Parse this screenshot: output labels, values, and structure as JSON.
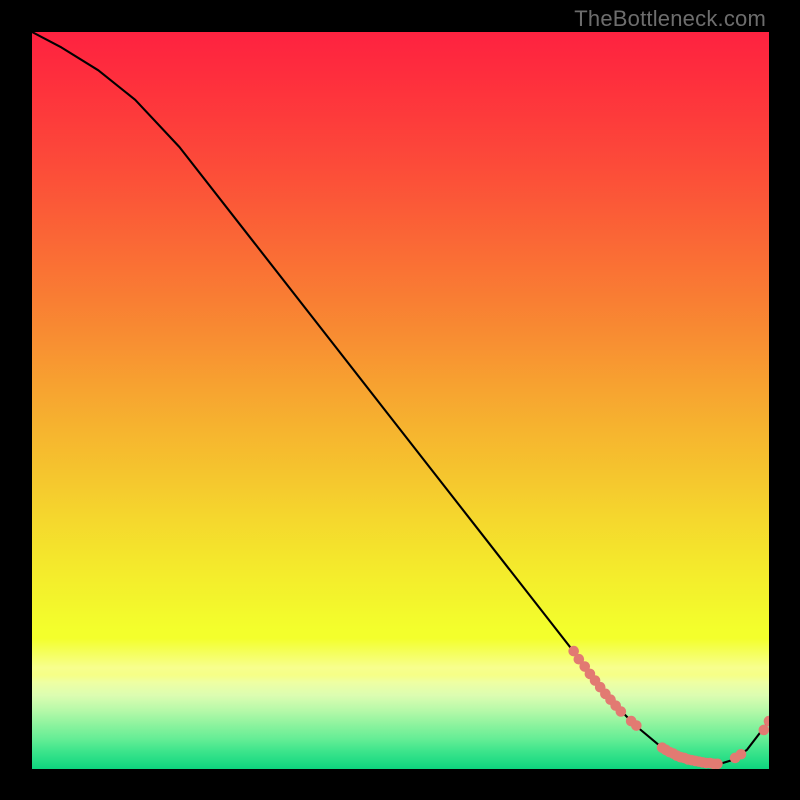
{
  "attribution": "TheBottleneck.com",
  "chart_data": {
    "type": "line",
    "title": "",
    "xlabel": "",
    "ylabel": "",
    "xlim": [
      0,
      100
    ],
    "ylim": [
      0,
      100
    ],
    "series": [
      {
        "name": "curve",
        "x": [
          0,
          4,
          9,
          14,
          20,
          30,
          40,
          50,
          60,
          70,
          75,
          78,
          80,
          82,
          85,
          88,
          91,
          93,
          95,
          97,
          100
        ],
        "y": [
          100,
          97.9,
          94.8,
          90.8,
          84.4,
          71.6,
          58.8,
          46.0,
          33.2,
          20.4,
          14.0,
          10.2,
          7.8,
          5.8,
          3.3,
          1.6,
          0.8,
          0.6,
          1.2,
          2.6,
          6.5
        ]
      }
    ],
    "markers": [
      {
        "name": "left-cluster",
        "points": [
          {
            "x": 73.5,
            "y": 16.0
          },
          {
            "x": 74.2,
            "y": 14.9
          },
          {
            "x": 75.0,
            "y": 13.9
          },
          {
            "x": 75.7,
            "y": 12.9
          },
          {
            "x": 76.4,
            "y": 12.0
          },
          {
            "x": 77.1,
            "y": 11.1
          },
          {
            "x": 77.8,
            "y": 10.2
          },
          {
            "x": 78.5,
            "y": 9.4
          },
          {
            "x": 79.2,
            "y": 8.6
          },
          {
            "x": 79.9,
            "y": 7.8
          }
        ]
      },
      {
        "name": "mid-pair",
        "points": [
          {
            "x": 81.3,
            "y": 6.5
          },
          {
            "x": 82.0,
            "y": 5.9
          }
        ]
      },
      {
        "name": "bottom-band",
        "points": [
          {
            "x": 85.5,
            "y": 2.9
          },
          {
            "x": 86.0,
            "y": 2.6
          },
          {
            "x": 86.5,
            "y": 2.3
          },
          {
            "x": 87.0,
            "y": 2.1
          },
          {
            "x": 87.5,
            "y": 1.8
          },
          {
            "x": 88.0,
            "y": 1.6
          },
          {
            "x": 88.5,
            "y": 1.5
          },
          {
            "x": 89.0,
            "y": 1.3
          },
          {
            "x": 89.5,
            "y": 1.2
          },
          {
            "x": 90.0,
            "y": 1.1
          },
          {
            "x": 90.5,
            "y": 1.0
          },
          {
            "x": 91.0,
            "y": 0.9
          },
          {
            "x": 91.5,
            "y": 0.8
          },
          {
            "x": 92.0,
            "y": 0.8
          },
          {
            "x": 92.5,
            "y": 0.7
          },
          {
            "x": 93.0,
            "y": 0.7
          }
        ]
      },
      {
        "name": "right-pair",
        "points": [
          {
            "x": 95.4,
            "y": 1.5
          },
          {
            "x": 96.2,
            "y": 2.0
          }
        ]
      },
      {
        "name": "tail-pair",
        "points": [
          {
            "x": 99.3,
            "y": 5.3
          },
          {
            "x": 100.0,
            "y": 6.5
          }
        ]
      }
    ],
    "marker_color": "#e27a72",
    "background_gradient": {
      "stops": [
        {
          "offset": 0.0,
          "color": "#fe2240"
        },
        {
          "offset": 0.06,
          "color": "#fe2e3d"
        },
        {
          "offset": 0.12,
          "color": "#fd3c3b"
        },
        {
          "offset": 0.18,
          "color": "#fc4b39"
        },
        {
          "offset": 0.24,
          "color": "#fb5b37"
        },
        {
          "offset": 0.3,
          "color": "#fa6c35"
        },
        {
          "offset": 0.36,
          "color": "#f97d33"
        },
        {
          "offset": 0.42,
          "color": "#f88f32"
        },
        {
          "offset": 0.48,
          "color": "#f7a230"
        },
        {
          "offset": 0.54,
          "color": "#f6b42f"
        },
        {
          "offset": 0.6,
          "color": "#f5c52e"
        },
        {
          "offset": 0.66,
          "color": "#f5d72d"
        },
        {
          "offset": 0.72,
          "color": "#f4e82c"
        },
        {
          "offset": 0.78,
          "color": "#f3f72c"
        },
        {
          "offset": 0.8125,
          "color": "#f3ff2c"
        },
        {
          "offset": 0.8225,
          "color": "#f3ff2c"
        },
        {
          "offset": 0.8625,
          "color": "#f7ff8e"
        },
        {
          "offset": 0.8725,
          "color": "#f6ff87"
        },
        {
          "offset": 0.8825,
          "color": "#eeffa3"
        },
        {
          "offset": 0.9,
          "color": "#dcfdb1"
        },
        {
          "offset": 0.92,
          "color": "#b7f9a9"
        },
        {
          "offset": 0.94,
          "color": "#8cf39e"
        },
        {
          "offset": 0.96,
          "color": "#63ed95"
        },
        {
          "offset": 0.975,
          "color": "#3fe58c"
        },
        {
          "offset": 0.99,
          "color": "#21dc84"
        },
        {
          "offset": 1.0,
          "color": "#0dd47e"
        }
      ]
    }
  }
}
